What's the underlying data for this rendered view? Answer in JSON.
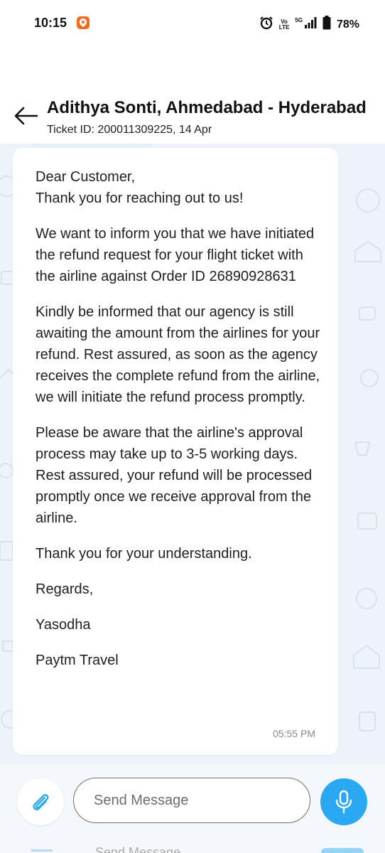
{
  "status_bar": {
    "time": "10:15",
    "battery": "78%",
    "network_5g": "5G",
    "volte_top": "Vo",
    "volte_bottom": "LTE"
  },
  "header": {
    "title": "Adithya Sonti, Ahmedabad - Hyderabad",
    "subtitle": "Ticket ID: 200011309225, 14 Apr"
  },
  "message": {
    "paragraphs": [
      "Dear Customer,\nThank you for reaching out to us!",
      "We want to inform you that we have initiated the refund request for your flight ticket with the airline against Order ID 26890928631",
      "Kindly be informed that our agency is still awaiting the amount from the airlines for your refund. Rest assured, as soon as the agency receives the complete refund from the airline, we will initiate the refund process promptly.",
      "Please be aware that the airline's approval process may take up to 3-5 working days. Rest assured, your refund will be processed promptly once we receive approval from the airline.",
      "Thank you for your understanding.",
      "Regards,",
      "Yasodha",
      "Paytm Travel"
    ],
    "time": "05:55 PM"
  },
  "composer": {
    "placeholder": "Send Message",
    "ghost_text": "Send Message"
  },
  "colors": {
    "chat_background": "#edf3f9",
    "accent": "#2aa9f2",
    "app_badge": "#f26b1d"
  },
  "icons": {
    "back": "arrow-left-icon",
    "attach": "paperclip-icon",
    "mic": "microphone-icon"
  }
}
